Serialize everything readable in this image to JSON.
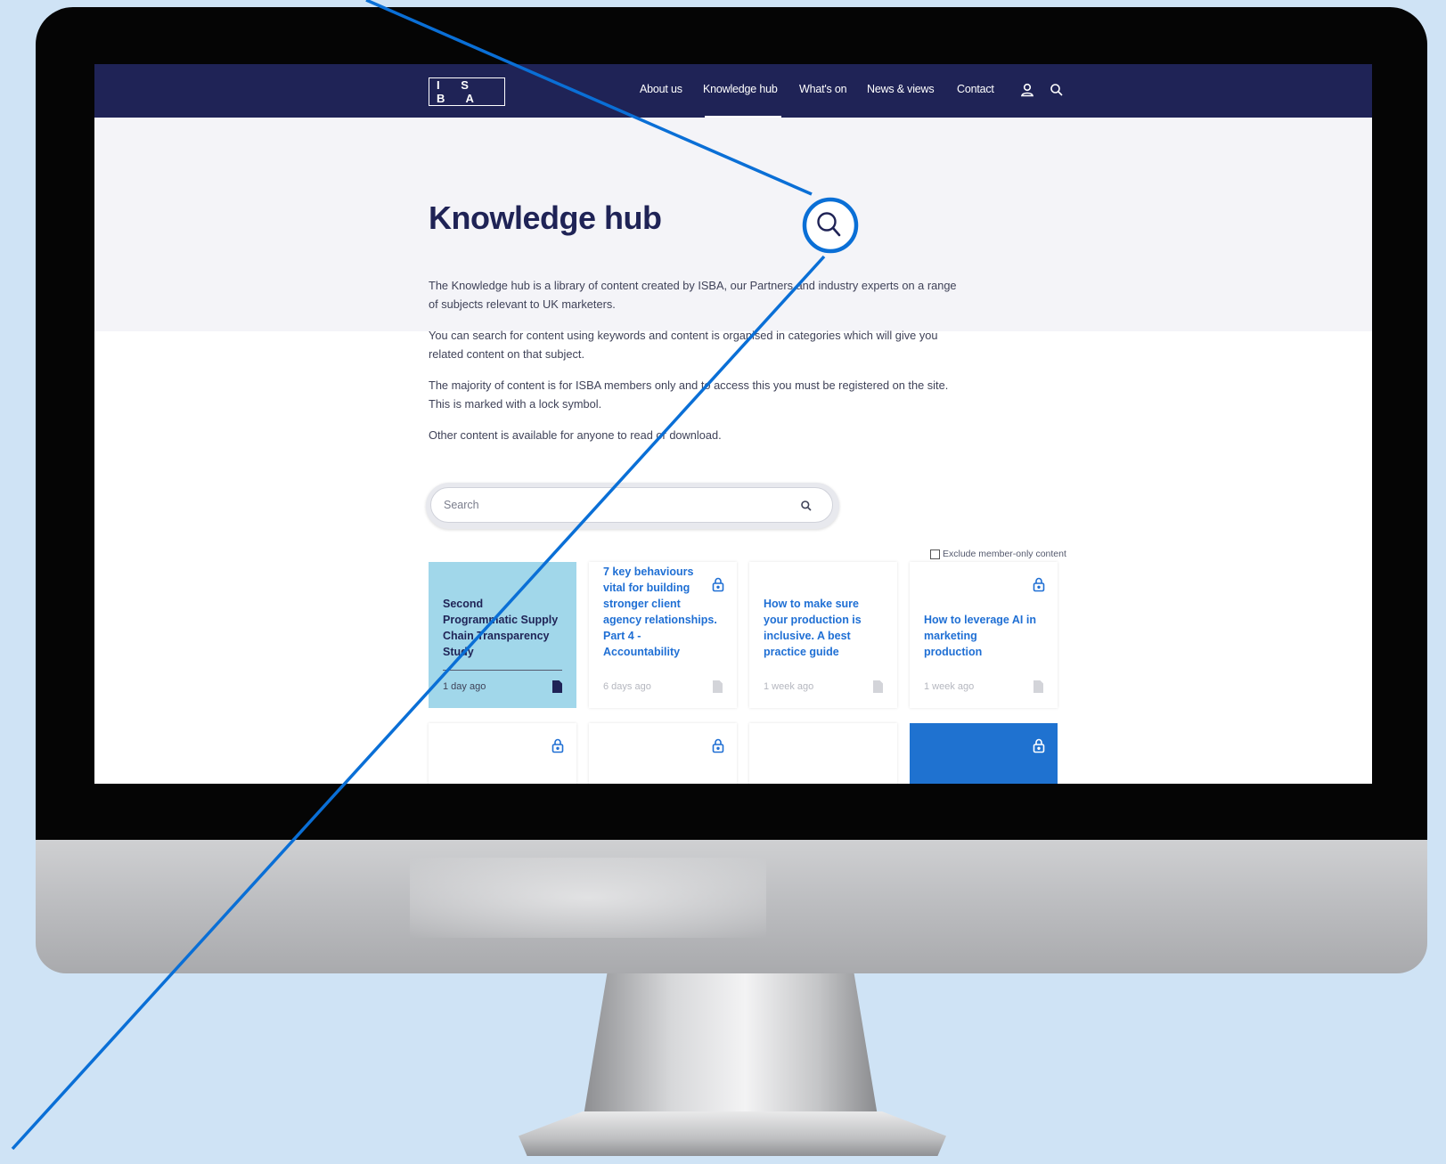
{
  "colors": {
    "navy": "#1f2356",
    "link_blue": "#1f6fd4",
    "featured_card": "#a1d7ea",
    "callout": "#0a6fd6",
    "page_background": "#cfe3f5"
  },
  "nav": {
    "logo": "I S B A",
    "items": [
      "About us",
      "Knowledge hub",
      "What's on",
      "News & views",
      "Contact"
    ],
    "active": "Knowledge hub",
    "icons": [
      "user-icon",
      "search-icon"
    ]
  },
  "page": {
    "title": "Knowledge hub",
    "intro": [
      "The Knowledge hub is a library of content created by ISBA, our Partners and industry experts on a range of subjects relevant to UK marketers.",
      "You can search for content using keywords and content is organised in categories which will give you related content on that subject.",
      "The majority of content is for ISBA members only and to access this you must be registered on the site. This is marked with a lock symbol.",
      "Other content is available for anyone to read or download."
    ]
  },
  "search": {
    "placeholder": "Search",
    "icon": "search-icon"
  },
  "filter": {
    "exclude_label": "Exclude member-only content",
    "checked": false
  },
  "cards": [
    {
      "title": "Second Programmatic Supply Chain Transparency Study",
      "date": "1 day ago",
      "locked": false,
      "featured": true
    },
    {
      "title": "7 key behaviours vital for building stronger client agency relationships. Part 4 - Accountability",
      "date": "6 days ago",
      "locked": true,
      "featured": false
    },
    {
      "title": "How to make sure your production is inclusive. A best practice guide",
      "date": "1 week ago",
      "locked": false,
      "featured": false
    },
    {
      "title": "How to leverage AI in marketing production",
      "date": "1 week ago",
      "locked": true,
      "featured": false
    }
  ],
  "next_row_cards": [
    {
      "locked": true
    },
    {
      "locked": true
    },
    {
      "locked": false
    },
    {
      "locked": true,
      "blue": true
    }
  ],
  "callout": {
    "icon": "magnifier-callout-icon"
  }
}
